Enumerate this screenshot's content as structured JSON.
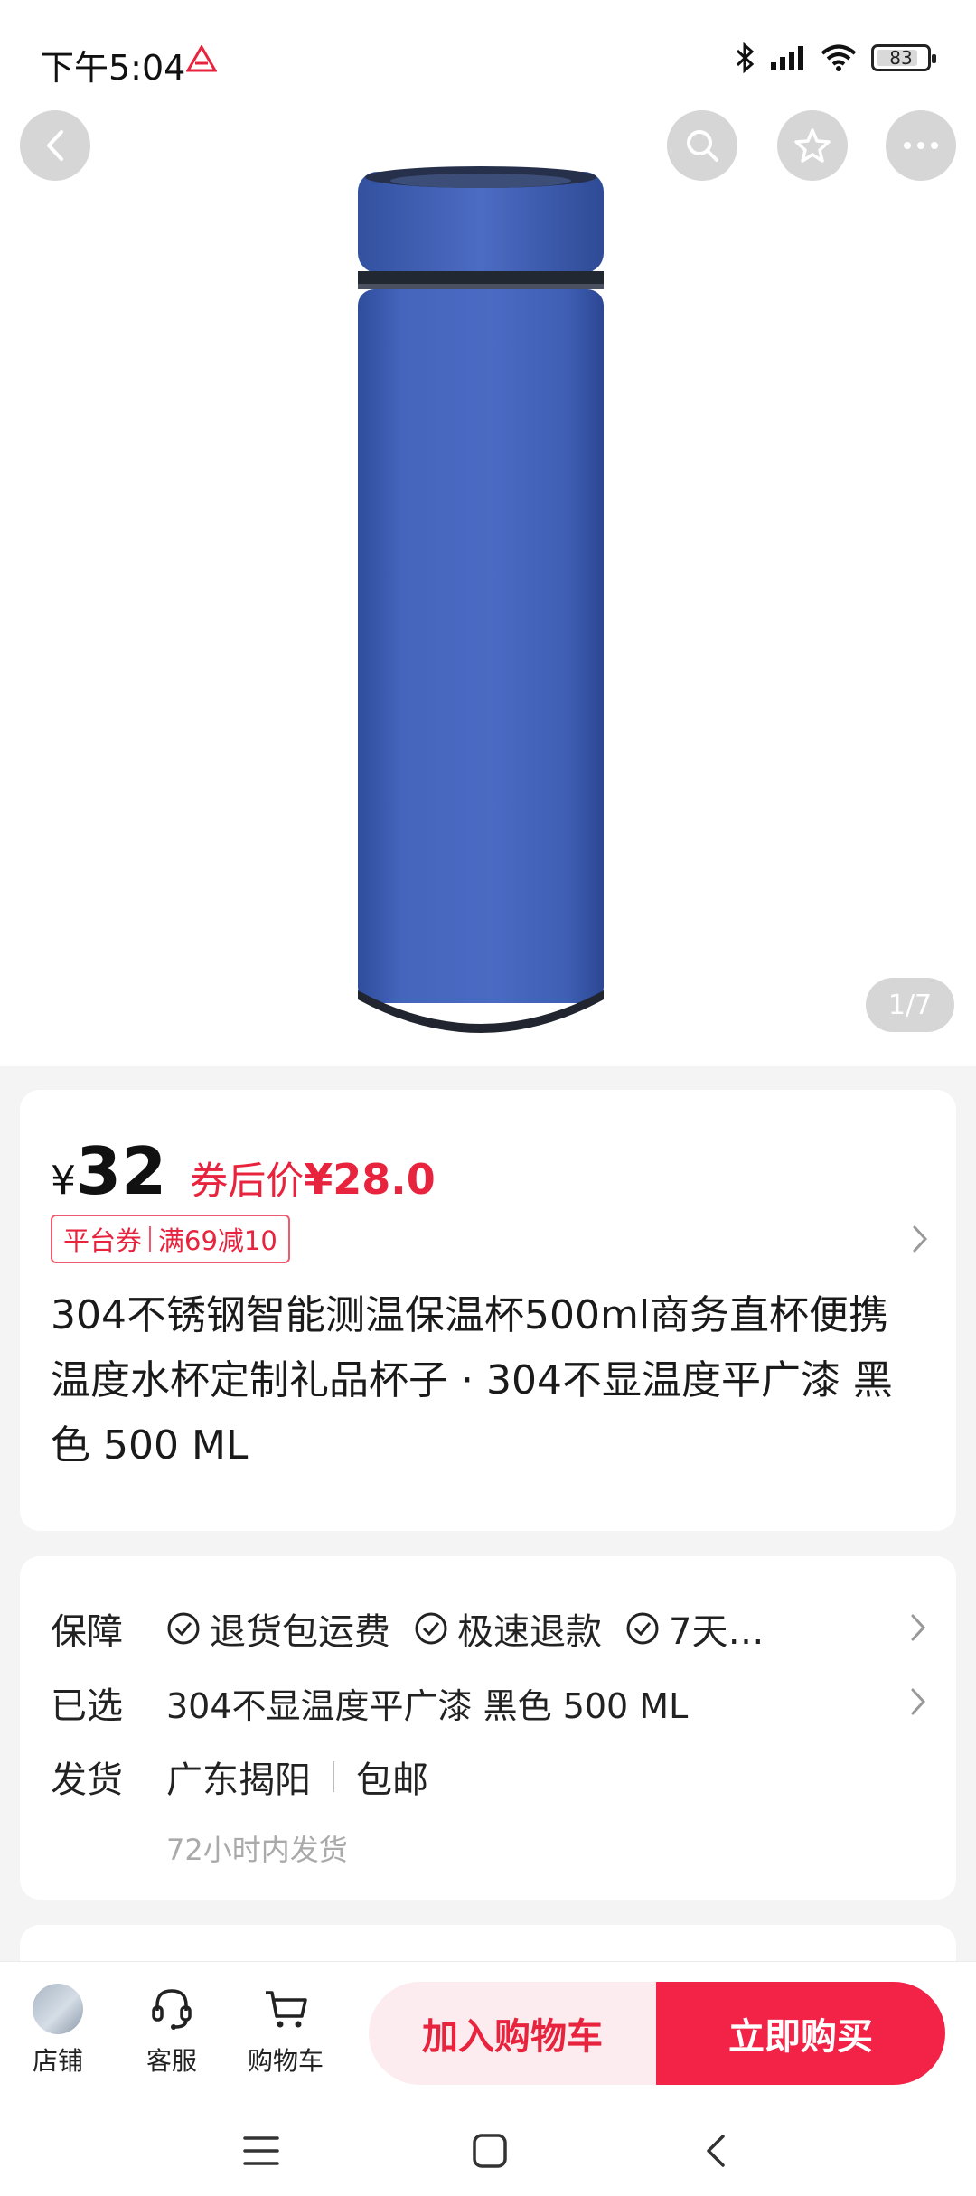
{
  "status_bar": {
    "time": "下午5:04",
    "battery": "83",
    "battery_level_percent": 83,
    "icons": [
      "app-notification-icon",
      "bluetooth-icon",
      "signal-icon",
      "wifi-icon",
      "battery-icon"
    ]
  },
  "gallery": {
    "counter": "1/7",
    "product_color": "#3f5fb5",
    "icons": [
      "back-arrow-icon",
      "search-icon",
      "star-icon",
      "more-dots-icon"
    ]
  },
  "price": {
    "symbol": "¥",
    "value": "32",
    "after_coupon_label": "券后价",
    "after_coupon_price": "¥28.0",
    "coupon_type": "平台券",
    "coupon_rule": "满69减10"
  },
  "product": {
    "title": "304不锈钢智能测温保温杯500ml商务直杯便携温度水杯定制礼品杯子 · 304不显温度平广漆 黑色 500 ML"
  },
  "service": {
    "guarantee_label": "保障",
    "guarantees": [
      "退货包运费",
      "极速退款",
      "7天…"
    ],
    "selected_label": "已选",
    "selected_value": "304不显温度平广漆 黑色 500 ML",
    "shipping_label": "发货",
    "shipping_origin": "广东揭阳",
    "shipping_fee": "包邮",
    "shipping_time": "72小时内发货"
  },
  "bottom_bar": {
    "shop_label": "店铺",
    "service_label": "客服",
    "cart_label": "购物车",
    "add_to_cart": "加入购物车",
    "buy_now": "立即购买"
  },
  "colors": {
    "accent": "#e8233d",
    "buy_button": "#f22346",
    "add_cart_bg": "#fdecef"
  }
}
